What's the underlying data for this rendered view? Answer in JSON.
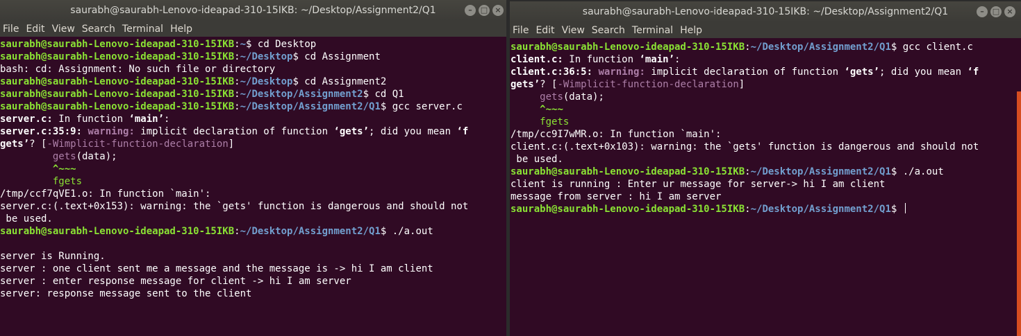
{
  "left": {
    "title": "saurabh@saurabh-Lenovo-ideapad-310-15IKB: ~/Desktop/Assignment2/Q1",
    "menu": [
      "File",
      "Edit",
      "View",
      "Search",
      "Terminal",
      "Help"
    ],
    "lines": [
      [
        [
          "u",
          "saurabh@saurabh-Lenovo-ideapad-310-15IKB"
        ],
        [
          "t",
          ":"
        ],
        [
          "p",
          "~"
        ],
        [
          "t",
          "$ cd Desktop"
        ]
      ],
      [
        [
          "u",
          "saurabh@saurabh-Lenovo-ideapad-310-15IKB"
        ],
        [
          "t",
          ":"
        ],
        [
          "p",
          "~/Desktop"
        ],
        [
          "t",
          "$ cd Assignment"
        ]
      ],
      [
        [
          "t",
          "bash: cd: Assignment: No such file or directory"
        ]
      ],
      [
        [
          "u",
          "saurabh@saurabh-Lenovo-ideapad-310-15IKB"
        ],
        [
          "t",
          ":"
        ],
        [
          "p",
          "~/Desktop"
        ],
        [
          "t",
          "$ cd Assignment2"
        ]
      ],
      [
        [
          "u",
          "saurabh@saurabh-Lenovo-ideapad-310-15IKB"
        ],
        [
          "t",
          ":"
        ],
        [
          "p",
          "~/Desktop/Assignment2"
        ],
        [
          "t",
          "$ cd Q1"
        ]
      ],
      [
        [
          "u",
          "saurabh@saurabh-Lenovo-ideapad-310-15IKB"
        ],
        [
          "t",
          ":"
        ],
        [
          "p",
          "~/Desktop/Assignment2/Q1"
        ],
        [
          "t",
          "$ gcc server.c"
        ]
      ],
      [
        [
          "b",
          "server.c:"
        ],
        [
          "t",
          " In function "
        ],
        [
          "b",
          "‘main’"
        ],
        [
          "t",
          ":"
        ]
      ],
      [
        [
          "b",
          "server.c:35:9: "
        ],
        [
          "w",
          "warning: "
        ],
        [
          "t",
          "implicit declaration of function "
        ],
        [
          "b",
          "‘gets’"
        ],
        [
          "t",
          "; did you mean "
        ],
        [
          "b",
          "‘f"
        ]
      ],
      [
        [
          "b",
          "gets’"
        ],
        [
          "t",
          "? ["
        ],
        [
          "m",
          "-Wimplicit-function-declaration"
        ],
        [
          "t",
          "]"
        ]
      ],
      [
        [
          "t",
          "         "
        ],
        [
          "gc",
          "gets"
        ],
        [
          "t",
          "(data);"
        ]
      ],
      [
        [
          "t",
          "         "
        ],
        [
          "c",
          "^~~~"
        ]
      ],
      [
        [
          "t",
          "         "
        ],
        [
          "g",
          "fgets"
        ]
      ],
      [
        [
          "t",
          "/tmp/ccf7qVE1.o: In function `main':"
        ]
      ],
      [
        [
          "t",
          "server.c:(.text+0x153): warning: the `gets' function is dangerous and should not"
        ]
      ],
      [
        [
          "t",
          " be used."
        ]
      ],
      [
        [
          "u",
          "saurabh@saurabh-Lenovo-ideapad-310-15IKB"
        ],
        [
          "t",
          ":"
        ],
        [
          "p",
          "~/Desktop/Assignment2/Q1"
        ],
        [
          "t",
          "$ ./a.out"
        ]
      ],
      [
        [
          "t",
          ""
        ]
      ],
      [
        [
          "t",
          "server is Running."
        ]
      ],
      [
        [
          "t",
          "server : one client sent me a message and the message is -> hi I am client"
        ]
      ],
      [
        [
          "t",
          "server : enter response message for client -> hi I am server"
        ]
      ],
      [
        [
          "t",
          "server: response message sent to the client"
        ]
      ]
    ]
  },
  "right": {
    "title": "saurabh@saurabh-Lenovo-ideapad-310-15IKB: ~/Desktop/Assignment2/Q1",
    "menu": [
      "File",
      "Edit",
      "View",
      "Search",
      "Terminal",
      "Help"
    ],
    "lines": [
      [
        [
          "u",
          "saurabh@saurabh-Lenovo-ideapad-310-15IKB"
        ],
        [
          "t",
          ":"
        ],
        [
          "p",
          "~/Desktop/Assignment2/Q1"
        ],
        [
          "t",
          "$ gcc client.c"
        ]
      ],
      [
        [
          "b",
          "client.c:"
        ],
        [
          "t",
          " In function "
        ],
        [
          "b",
          "‘main’"
        ],
        [
          "t",
          ":"
        ]
      ],
      [
        [
          "b",
          "client.c:36:5: "
        ],
        [
          "w",
          "warning: "
        ],
        [
          "t",
          "implicit declaration of function "
        ],
        [
          "b",
          "‘gets’"
        ],
        [
          "t",
          "; did you mean "
        ],
        [
          "b",
          "‘f"
        ]
      ],
      [
        [
          "b",
          "gets’"
        ],
        [
          "t",
          "? ["
        ],
        [
          "m",
          "-Wimplicit-function-declaration"
        ],
        [
          "t",
          "]"
        ]
      ],
      [
        [
          "t",
          "     "
        ],
        [
          "gc",
          "gets"
        ],
        [
          "t",
          "(data);"
        ]
      ],
      [
        [
          "t",
          "     "
        ],
        [
          "c",
          "^~~~"
        ]
      ],
      [
        [
          "t",
          "     "
        ],
        [
          "g",
          "fgets"
        ]
      ],
      [
        [
          "t",
          "/tmp/cc9I7wMR.o: In function `main':"
        ]
      ],
      [
        [
          "t",
          "client.c:(.text+0x103): warning: the `gets' function is dangerous and should not"
        ]
      ],
      [
        [
          "t",
          " be used."
        ]
      ],
      [
        [
          "u",
          "saurabh@saurabh-Lenovo-ideapad-310-15IKB"
        ],
        [
          "t",
          ":"
        ],
        [
          "p",
          "~/Desktop/Assignment2/Q1"
        ],
        [
          "t",
          "$ ./a.out"
        ]
      ],
      [
        [
          "t",
          "client is running : Enter ur message for server-> hi I am client"
        ]
      ],
      [
        [
          "t",
          "message from server : hi I am server"
        ]
      ],
      [
        [
          "u",
          "saurabh@saurabh-Lenovo-ideapad-310-15IKB"
        ],
        [
          "t",
          ":"
        ],
        [
          "p",
          "~/Desktop/Assignment2/Q1"
        ],
        [
          "t",
          "$ "
        ]
      ]
    ]
  },
  "wm_glyphs": {
    "minimize": "–",
    "maximize": "□",
    "close": "×"
  }
}
